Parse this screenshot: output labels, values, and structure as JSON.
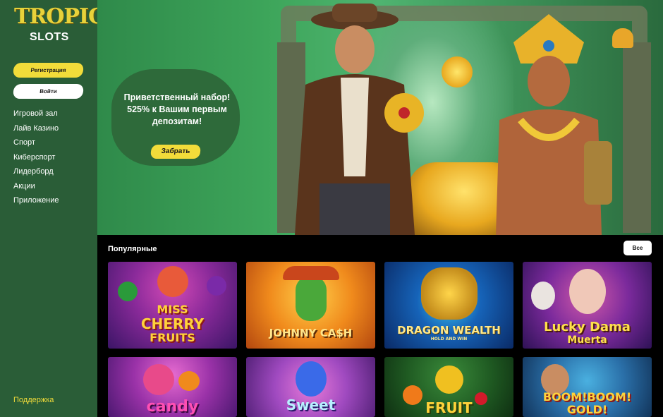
{
  "brand": {
    "logo_line1": "TROPIC",
    "logo_line2": "SLOTS"
  },
  "sidebar": {
    "register_label": "Регистрация",
    "login_label": "Войти",
    "nav": [
      {
        "label": "Игровой зал"
      },
      {
        "label": "Лайв Казино"
      },
      {
        "label": "Спорт"
      },
      {
        "label": "Киберспорт"
      },
      {
        "label": "Лидерборд"
      },
      {
        "label": "Акции"
      },
      {
        "label": "Приложение"
      }
    ],
    "support_label": "Поддержка"
  },
  "banner": {
    "offer_line1": "Приветственный набор!",
    "offer_line2": "525% к Вашим первым",
    "offer_line3": "депозитам!",
    "claim_label": "Забрать"
  },
  "popular": {
    "title": "Популярные",
    "all_label": "Все",
    "games": [
      {
        "name_line1": "MISS",
        "name_line2": "CHERRY",
        "name_line3": "FRUITS"
      },
      {
        "name_line1": "JOHNNY CA$H"
      },
      {
        "name_line1": "DRAGON WEALTH",
        "name_line2": "HOLD AND WIN"
      },
      {
        "name_line1": "Lucky Dama",
        "name_line2": "Muerta"
      },
      {
        "name_line1": "candy"
      },
      {
        "name_line1": "Sweet"
      },
      {
        "name_line1": "FRUIT"
      },
      {
        "name_line1": "BOOM!BOOM!",
        "name_line2": "GOLD!"
      }
    ]
  },
  "colors": {
    "sidebar_bg": "#2a5d37",
    "accent_yellow": "#f2dc3a",
    "content_bg": "#000000"
  }
}
